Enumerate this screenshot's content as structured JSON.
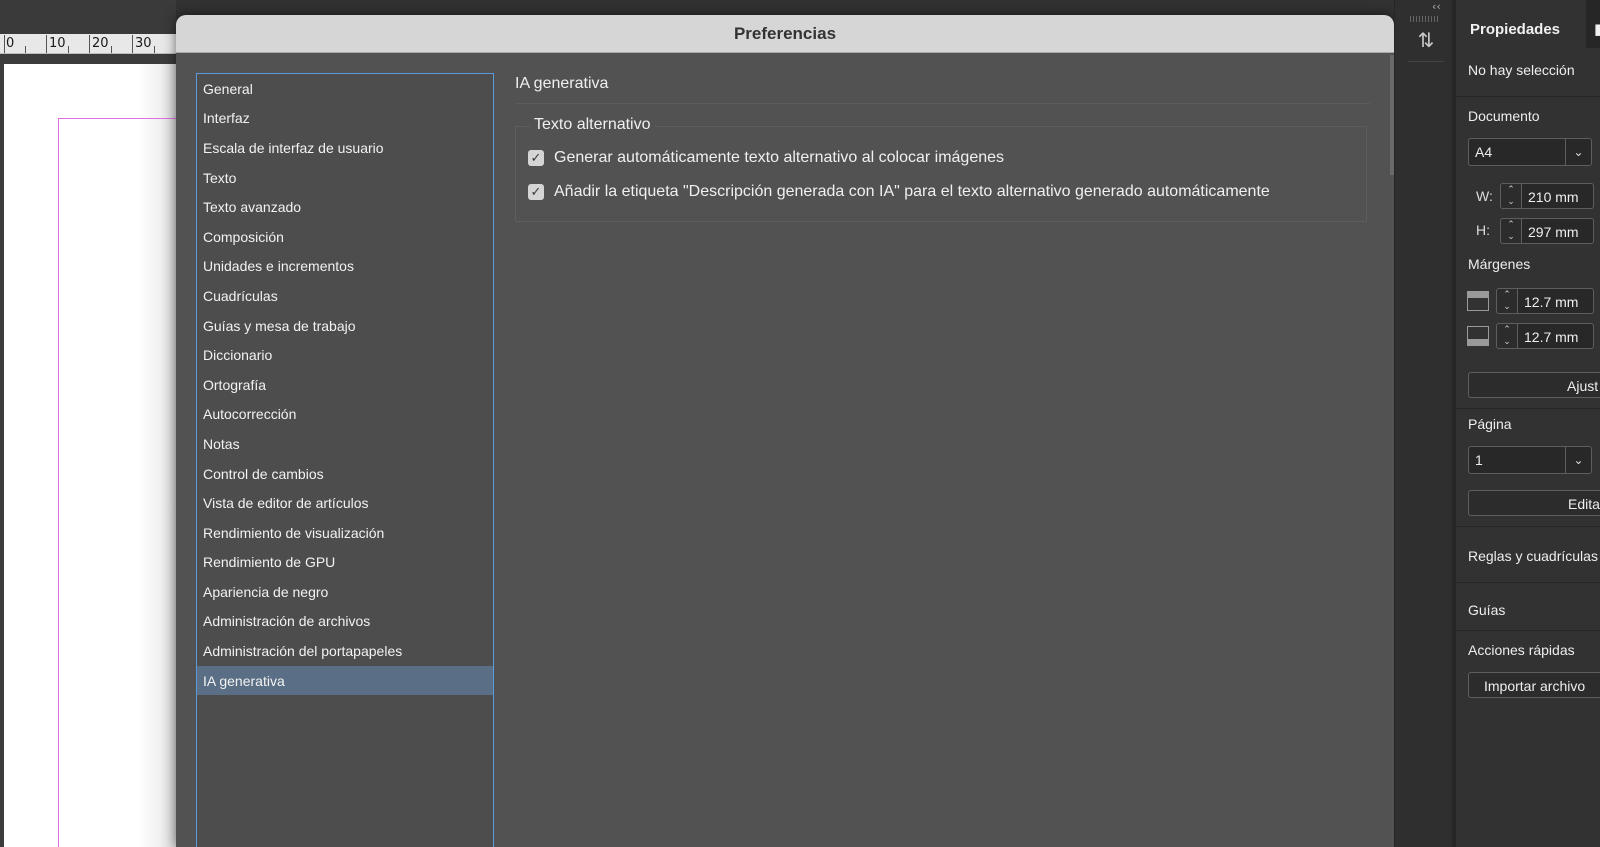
{
  "canvas": {
    "ruler_labels": [
      "0",
      "10",
      "20",
      "30"
    ]
  },
  "dialog": {
    "title": "Preferencias",
    "nav_items": [
      {
        "label": "General"
      },
      {
        "label": "Interfaz"
      },
      {
        "label": "Escala de interfaz de usuario"
      },
      {
        "label": "Texto"
      },
      {
        "label": "Texto avanzado"
      },
      {
        "label": "Composición"
      },
      {
        "label": "Unidades e incrementos"
      },
      {
        "label": "Cuadrículas"
      },
      {
        "label": "Guías y mesa de trabajo"
      },
      {
        "label": "Diccionario"
      },
      {
        "label": "Ortografía"
      },
      {
        "label": "Autocorrección"
      },
      {
        "label": "Notas"
      },
      {
        "label": "Control de cambios"
      },
      {
        "label": "Vista de editor de artículos"
      },
      {
        "label": "Rendimiento de visualización"
      },
      {
        "label": "Rendimiento de GPU"
      },
      {
        "label": "Apariencia de negro"
      },
      {
        "label": "Administración de archivos"
      },
      {
        "label": "Administración del portapapeles"
      },
      {
        "label": "IA generativa"
      }
    ],
    "selected_nav": "IA generativa",
    "section_title": "IA generativa",
    "group_title": "Texto alternativo",
    "options": [
      {
        "label": "Generar automáticamente texto alternativo al colocar imágenes",
        "checked": true
      },
      {
        "label": "Añadir la etiqueta \"Descripción generada con IA\" para el texto alternativo generado automáticamente",
        "checked": true
      }
    ]
  },
  "properties": {
    "tab_label": "Propiedades",
    "selection_status": "No hay selección",
    "document_label": "Documento",
    "page_size": "A4",
    "width_label": "W:",
    "width_value": "210 mm",
    "height_label": "H:",
    "height_value": "297 mm",
    "margins_label": "Márgenes",
    "margin_top": "12.7 mm",
    "margin_bottom": "12.7 mm",
    "adjust_button": "Ajust",
    "page_label": "Página",
    "page_value": "1",
    "edit_button": "Edita",
    "rulers_label": "Reglas y cuadrículas",
    "guides_label": "Guías",
    "quick_actions_label": "Acciones rápidas",
    "import_button": "Importar archivo"
  },
  "colors": {
    "selection_highlight": "#5a6e85",
    "focus_border": "#5b9bdc",
    "margin_guide": "#e070e0"
  }
}
